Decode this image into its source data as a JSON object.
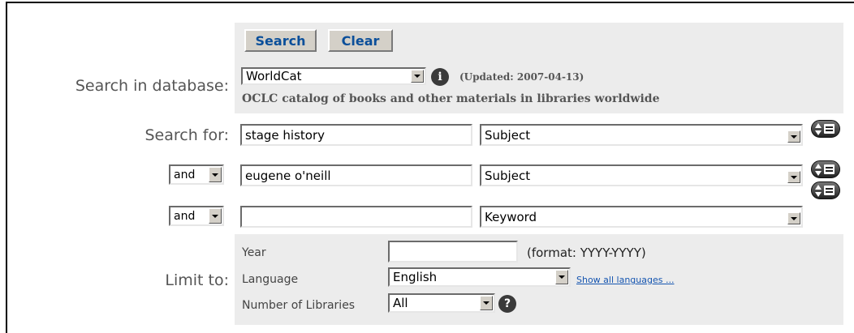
{
  "toolbar": {
    "search_label": "Search",
    "clear_label": "Clear"
  },
  "database": {
    "label": "Search in database:",
    "selected": "WorldCat",
    "updated": "(Updated: 2007-04-13)",
    "description": "OCLC catalog of books and other materials in libraries worldwide"
  },
  "search_for": {
    "label": "Search for:"
  },
  "rows": [
    {
      "operator": "",
      "term": "stage history",
      "index": "Subject"
    },
    {
      "operator": "and",
      "term": "eugene o'neill",
      "index": "Subject"
    },
    {
      "operator": "and",
      "term": "",
      "index": "Keyword"
    }
  ],
  "limit": {
    "label": "Limit to:",
    "year_label": "Year",
    "year_value": "",
    "year_format": "(format: YYYY-YYYY)",
    "language_label": "Language",
    "language_value": "English",
    "show_all_languages": "Show all languages ...",
    "libraries_label": "Number of Libraries",
    "libraries_value": "All"
  },
  "icons": {
    "info": "info-icon",
    "help": "help-icon",
    "more_options": "more-options-icon"
  },
  "colors": {
    "button_text": "#0b4f9a",
    "link": "#1555b0",
    "panel": "#ececec"
  }
}
